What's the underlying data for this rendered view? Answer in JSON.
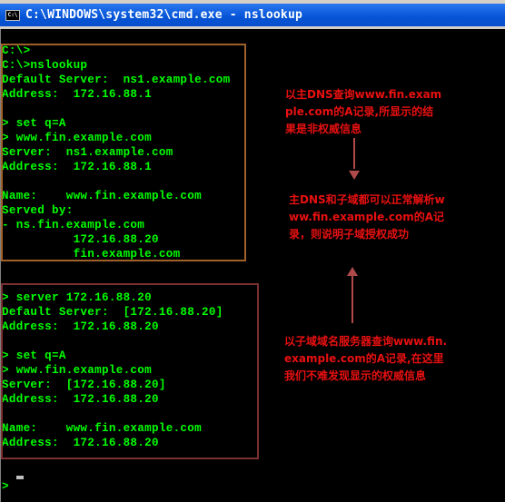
{
  "window": {
    "title": "C:\\WINDOWS\\system32\\cmd.exe - nslookup",
    "icon": "cmd-icon",
    "icon_label": "C:\\"
  },
  "console": {
    "text_color": "#00ff00",
    "background": "#000000",
    "lines": [
      "C:\\>",
      "C:\\>nslookup",
      "Default Server:  ns1.example.com",
      "Address:  172.16.88.1",
      "",
      "> set q=A",
      "> www.fin.example.com",
      "Server:  ns1.example.com",
      "Address:  172.16.88.1",
      "",
      "Name:    www.fin.example.com",
      "Served by:",
      "- ns.fin.example.com",
      "          172.16.88.20",
      "          fin.example.com",
      "",
      "",
      "> server 172.16.88.20",
      "Default Server:  [172.16.88.20]",
      "Address:  172.16.88.20",
      "",
      "> set q=A",
      "> www.fin.example.com",
      "Server:  [172.16.88.20]",
      "Address:  172.16.88.20",
      "",
      "Name:    www.fin.example.com",
      "Address:  172.16.88.20",
      "",
      "",
      "> "
    ]
  },
  "annotations": {
    "color": "#e81010",
    "note1": [
      "以主DNS查询www.fin.exam",
      "ple.com的A记录,所显示的结",
      "果是非权威信息"
    ],
    "note2": [
      "主DNS和子域都可以正常解析w",
      "ww.fin.example.com的A记",
      "录，则说明子域授权成功"
    ],
    "note3": [
      "以子域域名服务器查询www.fin.",
      "example.com的A记录,在这里",
      "我们不难发现显示的权威信息"
    ],
    "box1_color": "#a0602a",
    "box2_color": "#7a3030"
  }
}
